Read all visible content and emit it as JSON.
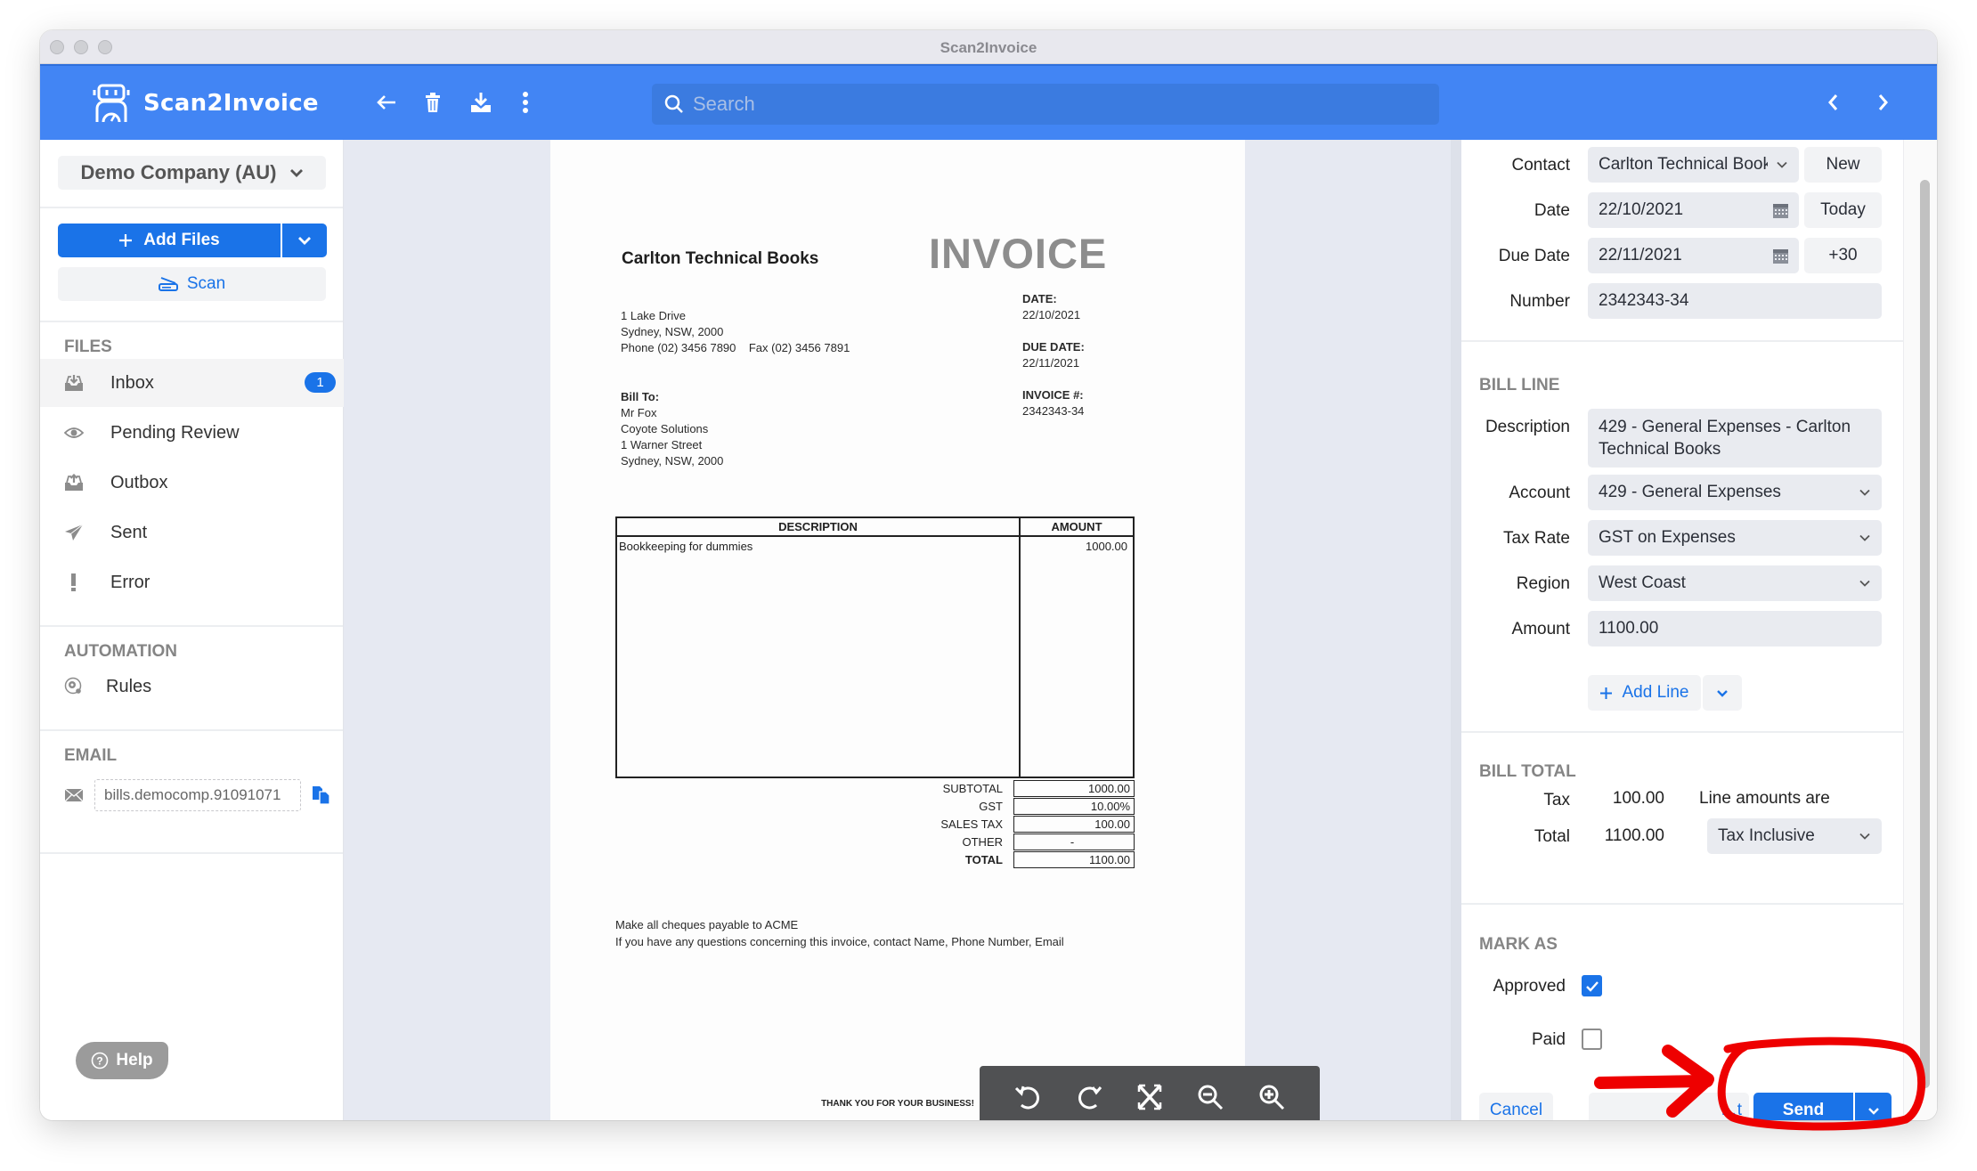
{
  "window": {
    "title": "Scan2Invoice"
  },
  "header": {
    "app_name": "Scan2Invoice",
    "search_placeholder": "Search",
    "search_value": "",
    "icons": [
      "back-arrow-icon",
      "trash-icon",
      "download-icon",
      "more-vertical-icon"
    ],
    "nav_icons": [
      "chevron-left-icon",
      "chevron-right-icon"
    ]
  },
  "sidebar": {
    "company": "Demo Company (AU)",
    "add_files_label": "Add Files",
    "scan_label": "Scan",
    "files_title": "FILES",
    "items": [
      {
        "label": "Inbox",
        "icon": "inbox-icon",
        "badge": "1",
        "active": true
      },
      {
        "label": "Pending Review",
        "icon": "eye-icon"
      },
      {
        "label": "Outbox",
        "icon": "outbox-icon"
      },
      {
        "label": "Sent",
        "icon": "paper-plane-icon"
      },
      {
        "label": "Error",
        "icon": "exclamation-icon"
      }
    ],
    "automation_title": "AUTOMATION",
    "automation_items": [
      {
        "label": "Rules",
        "icon": "rules-gear-icon"
      }
    ],
    "email_title": "EMAIL",
    "email_value": "bills.democomp.91091071",
    "help_label": "Help"
  },
  "document": {
    "company": "Carlton Technical Books",
    "title": "INVOICE",
    "address": [
      "1 Lake Drive",
      "Sydney, NSW, 2000"
    ],
    "phone": "Phone (02) 3456 7890",
    "fax": "Fax (02) 3456 7891",
    "bill_to_label": "Bill To:",
    "bill_to": [
      "Mr Fox",
      "Coyote Solutions",
      "1 Warner Street",
      "Sydney, NSW, 2000"
    ],
    "date_label": "DATE:",
    "date": "22/10/2021",
    "due_date_label": "DUE DATE:",
    "due_date": "22/11/2021",
    "invoice_no_label": "INVOICE #:",
    "invoice_no": "2342343-34",
    "table_headers": [
      "DESCRIPTION",
      "AMOUNT"
    ],
    "lines": [
      {
        "description": "Bookkeeping for dummies",
        "amount": "1000.00"
      }
    ],
    "totals": [
      {
        "label": "SUBTOTAL",
        "value": "1000.00"
      },
      {
        "label": "GST",
        "value": "10.00%"
      },
      {
        "label": "SALES TAX",
        "value": "100.00"
      },
      {
        "label": "OTHER",
        "value": "-"
      },
      {
        "label": "TOTAL",
        "value": "1100.00",
        "bold": true
      }
    ],
    "note_1": "Make all cheques payable to ACME",
    "note_2": "If you have any questions concerning this invoice, contact Name, Phone Number, Email",
    "thanks": "THANK YOU FOR YOUR BUSINESS!"
  },
  "viewer_tools": [
    "rotate-left-icon",
    "rotate-right-icon",
    "fit-expand-icon",
    "zoom-out-icon",
    "zoom-in-icon"
  ],
  "form": {
    "contact_label": "Contact",
    "contact_value": "Carlton Technical Books",
    "new_label": "New",
    "date_label": "Date",
    "date_value": "22/10/2021",
    "today_label": "Today",
    "due_date_label": "Due Date",
    "due_date_value": "22/11/2021",
    "plus30_label": "+30",
    "number_label": "Number",
    "number_value": "2342343-34",
    "bill_line_title": "BILL LINE",
    "description_label": "Description",
    "description_value": "429 - General Expenses - Carlton Technical Books",
    "account_label": "Account",
    "account_value": "429 - General Expenses",
    "tax_rate_label": "Tax Rate",
    "tax_rate_value": "GST on Expenses",
    "region_label": "Region",
    "region_value": "West Coast",
    "amount_label": "Amount",
    "amount_value": "1100.00",
    "add_line_label": "Add Line",
    "bill_total_title": "BILL TOTAL",
    "tax_label": "Tax",
    "tax_value": "100.00",
    "total_label": "Total",
    "total_value": "1100.00",
    "line_amounts_label": "Line amounts are",
    "line_amounts_value": "Tax Inclusive",
    "mark_as_title": "MARK AS",
    "approved_label": "Approved",
    "approved_checked": true,
    "paid_label": "Paid",
    "paid_checked": false,
    "cancel_label": "Cancel",
    "middle_button_label": "…t",
    "send_label": "Send"
  },
  "colors": {
    "brand_blue": "#4285f4",
    "primary_button": "#1a73e8",
    "annotation_red": "#ee0000"
  }
}
